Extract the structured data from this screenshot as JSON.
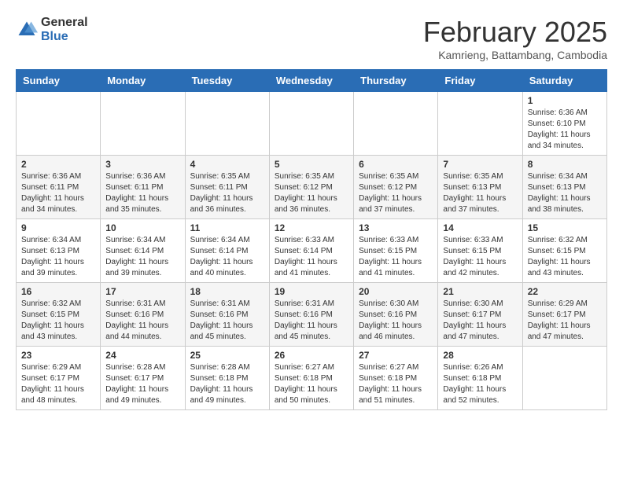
{
  "header": {
    "logo": {
      "general": "General",
      "blue": "Blue"
    },
    "title": "February 2025",
    "subtitle": "Kamrieng, Battambang, Cambodia"
  },
  "calendar": {
    "days_of_week": [
      "Sunday",
      "Monday",
      "Tuesday",
      "Wednesday",
      "Thursday",
      "Friday",
      "Saturday"
    ],
    "weeks": [
      [
        {
          "day": "",
          "info": ""
        },
        {
          "day": "",
          "info": ""
        },
        {
          "day": "",
          "info": ""
        },
        {
          "day": "",
          "info": ""
        },
        {
          "day": "",
          "info": ""
        },
        {
          "day": "",
          "info": ""
        },
        {
          "day": "1",
          "info": "Sunrise: 6:36 AM\nSunset: 6:10 PM\nDaylight: 11 hours\nand 34 minutes."
        }
      ],
      [
        {
          "day": "2",
          "info": "Sunrise: 6:36 AM\nSunset: 6:11 PM\nDaylight: 11 hours\nand 34 minutes."
        },
        {
          "day": "3",
          "info": "Sunrise: 6:36 AM\nSunset: 6:11 PM\nDaylight: 11 hours\nand 35 minutes."
        },
        {
          "day": "4",
          "info": "Sunrise: 6:35 AM\nSunset: 6:11 PM\nDaylight: 11 hours\nand 36 minutes."
        },
        {
          "day": "5",
          "info": "Sunrise: 6:35 AM\nSunset: 6:12 PM\nDaylight: 11 hours\nand 36 minutes."
        },
        {
          "day": "6",
          "info": "Sunrise: 6:35 AM\nSunset: 6:12 PM\nDaylight: 11 hours\nand 37 minutes."
        },
        {
          "day": "7",
          "info": "Sunrise: 6:35 AM\nSunset: 6:13 PM\nDaylight: 11 hours\nand 37 minutes."
        },
        {
          "day": "8",
          "info": "Sunrise: 6:34 AM\nSunset: 6:13 PM\nDaylight: 11 hours\nand 38 minutes."
        }
      ],
      [
        {
          "day": "9",
          "info": "Sunrise: 6:34 AM\nSunset: 6:13 PM\nDaylight: 11 hours\nand 39 minutes."
        },
        {
          "day": "10",
          "info": "Sunrise: 6:34 AM\nSunset: 6:14 PM\nDaylight: 11 hours\nand 39 minutes."
        },
        {
          "day": "11",
          "info": "Sunrise: 6:34 AM\nSunset: 6:14 PM\nDaylight: 11 hours\nand 40 minutes."
        },
        {
          "day": "12",
          "info": "Sunrise: 6:33 AM\nSunset: 6:14 PM\nDaylight: 11 hours\nand 41 minutes."
        },
        {
          "day": "13",
          "info": "Sunrise: 6:33 AM\nSunset: 6:15 PM\nDaylight: 11 hours\nand 41 minutes."
        },
        {
          "day": "14",
          "info": "Sunrise: 6:33 AM\nSunset: 6:15 PM\nDaylight: 11 hours\nand 42 minutes."
        },
        {
          "day": "15",
          "info": "Sunrise: 6:32 AM\nSunset: 6:15 PM\nDaylight: 11 hours\nand 43 minutes."
        }
      ],
      [
        {
          "day": "16",
          "info": "Sunrise: 6:32 AM\nSunset: 6:15 PM\nDaylight: 11 hours\nand 43 minutes."
        },
        {
          "day": "17",
          "info": "Sunrise: 6:31 AM\nSunset: 6:16 PM\nDaylight: 11 hours\nand 44 minutes."
        },
        {
          "day": "18",
          "info": "Sunrise: 6:31 AM\nSunset: 6:16 PM\nDaylight: 11 hours\nand 45 minutes."
        },
        {
          "day": "19",
          "info": "Sunrise: 6:31 AM\nSunset: 6:16 PM\nDaylight: 11 hours\nand 45 minutes."
        },
        {
          "day": "20",
          "info": "Sunrise: 6:30 AM\nSunset: 6:16 PM\nDaylight: 11 hours\nand 46 minutes."
        },
        {
          "day": "21",
          "info": "Sunrise: 6:30 AM\nSunset: 6:17 PM\nDaylight: 11 hours\nand 47 minutes."
        },
        {
          "day": "22",
          "info": "Sunrise: 6:29 AM\nSunset: 6:17 PM\nDaylight: 11 hours\nand 47 minutes."
        }
      ],
      [
        {
          "day": "23",
          "info": "Sunrise: 6:29 AM\nSunset: 6:17 PM\nDaylight: 11 hours\nand 48 minutes."
        },
        {
          "day": "24",
          "info": "Sunrise: 6:28 AM\nSunset: 6:17 PM\nDaylight: 11 hours\nand 49 minutes."
        },
        {
          "day": "25",
          "info": "Sunrise: 6:28 AM\nSunset: 6:18 PM\nDaylight: 11 hours\nand 49 minutes."
        },
        {
          "day": "26",
          "info": "Sunrise: 6:27 AM\nSunset: 6:18 PM\nDaylight: 11 hours\nand 50 minutes."
        },
        {
          "day": "27",
          "info": "Sunrise: 6:27 AM\nSunset: 6:18 PM\nDaylight: 11 hours\nand 51 minutes."
        },
        {
          "day": "28",
          "info": "Sunrise: 6:26 AM\nSunset: 6:18 PM\nDaylight: 11 hours\nand 52 minutes."
        },
        {
          "day": "",
          "info": ""
        }
      ]
    ]
  }
}
